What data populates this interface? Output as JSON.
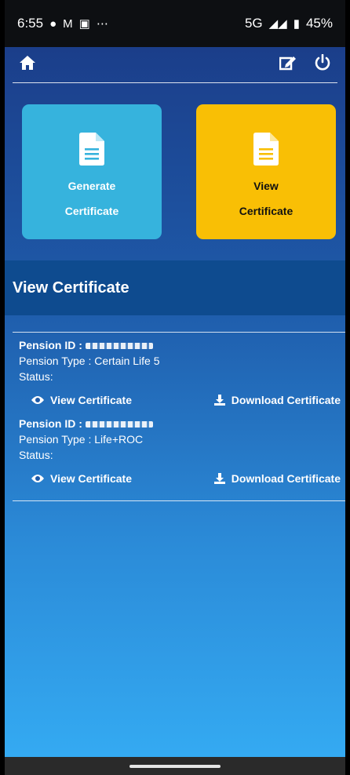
{
  "status_bar": {
    "time": "6:55",
    "network": "5G",
    "battery": "45%",
    "icons": [
      "chat-icon",
      "gmail-icon",
      "app-icon",
      "dots-icon",
      "signal-icon",
      "battery-icon"
    ]
  },
  "topbar": {
    "icons": [
      "home-icon",
      "edit-icon",
      "power-icon"
    ]
  },
  "tiles": {
    "generate": {
      "label_line1": "Generate",
      "label_line2": "Certificate",
      "color": "#36b3dd"
    },
    "view": {
      "label_line1": "View",
      "label_line2": "Certificate",
      "color": "#f9bf05"
    }
  },
  "section": {
    "title": "View Certificate"
  },
  "certificates": [
    {
      "pension_id_label": "Pension ID : ",
      "pension_type": "Pension Type : Certain Life 5",
      "status": "Status:",
      "view_label": "View Certificate",
      "download_label": "Download Certificate"
    },
    {
      "pension_id_label": "Pension ID : ",
      "pension_type": "Pension Type : Life+ROC",
      "status": "Status:",
      "view_label": "View Certificate",
      "download_label": "Download Certificate"
    }
  ]
}
